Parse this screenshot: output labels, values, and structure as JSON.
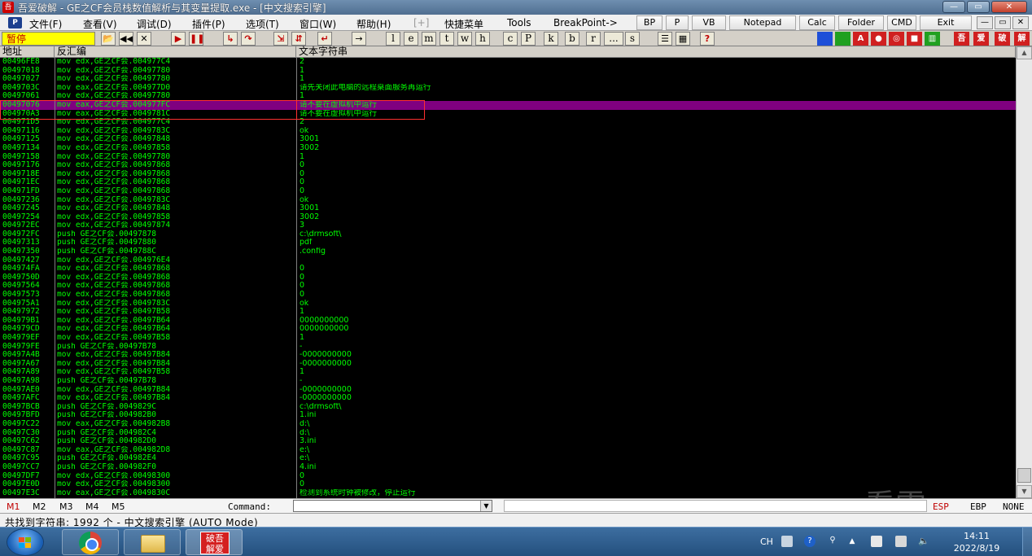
{
  "window": {
    "app_icon": "吾",
    "title": "吾爱破解 - GE之CF会员栈数值解析与其变量提取.exe - [中文搜索引擎]",
    "buttons": [
      "—",
      "▭",
      "✕"
    ]
  },
  "menubar": {
    "icon": "P",
    "items": [
      "文件(F)",
      "查看(V)",
      "调试(D)",
      "插件(P)",
      "选项(T)",
      "窗口(W)",
      "帮助(H)",
      "[+]",
      "快捷菜单",
      "Tools",
      "BreakPoint->"
    ],
    "quick_buttons": [
      "BP",
      "P",
      "VB",
      "Notepad",
      "Calc",
      "Folder",
      "CMD",
      "Exit"
    ],
    "mdi_buttons": [
      "—",
      "▭",
      "✕"
    ]
  },
  "toolbar": {
    "status": "暂停",
    "letters": [
      "l",
      "e",
      "m",
      "t",
      "w",
      "h",
      "c",
      "P",
      "k",
      "b",
      "r",
      "...",
      "s"
    ],
    "right_labels": [
      "吾",
      "爱",
      "破",
      "解"
    ],
    "right_colors": [
      "#1e4fd8",
      "#20a020",
      "#d02020",
      "#d02020",
      "#d02020",
      "#d02020",
      "#20a020",
      "#d02020",
      "#d02020",
      "#d02020",
      "#d02020"
    ]
  },
  "columns": {
    "address": "地址",
    "disasm": "反汇编",
    "text": "文本字符串"
  },
  "rows": [
    {
      "addr": "00496FE8",
      "asm": "mov edx,GE之CF会.004977C4",
      "text": "2"
    },
    {
      "addr": "00497018",
      "asm": "mov edx,GE之CF会.00497780",
      "text": "1"
    },
    {
      "addr": "00497027",
      "asm": "mov edx,GE之CF会.00497780",
      "text": "1"
    },
    {
      "addr": "0049703C",
      "asm": "mov eax,GE之CF会.004977D0",
      "text": "请先关闭此电脑的远程桌面服务再运行"
    },
    {
      "addr": "00497061",
      "asm": "mov edx,GE之CF会.00497780",
      "text": "1"
    },
    {
      "addr": "00497076",
      "asm": "mov eax,GE之CF会.004977FC",
      "text": "请不要在虚拟机中运行"
    },
    {
      "addr": "004970A3",
      "asm": "mov eax,GE之CF会.0049781C",
      "text": "请不要在虚拟机中运行"
    },
    {
      "addr": "004971D5",
      "asm": "mov edx,GE之CF会.004977C4",
      "text": "2"
    },
    {
      "addr": "00497116",
      "asm": "mov edx,GE之CF会.0049783C",
      "text": "ok"
    },
    {
      "addr": "00497125",
      "asm": "mov edx,GE之CF会.00497848",
      "text": "3001"
    },
    {
      "addr": "00497134",
      "asm": "mov edx,GE之CF会.00497858",
      "text": "3002"
    },
    {
      "addr": "00497158",
      "asm": "mov edx,GE之CF会.00497780",
      "text": "1"
    },
    {
      "addr": "00497176",
      "asm": "mov edx,GE之CF会.00497868",
      "text": "0"
    },
    {
      "addr": "0049718E",
      "asm": "mov edx,GE之CF会.00497868",
      "text": "0"
    },
    {
      "addr": "004971EC",
      "asm": "mov edx,GE之CF会.00497868",
      "text": "0"
    },
    {
      "addr": "004971FD",
      "asm": "mov edx,GE之CF会.00497868",
      "text": "0"
    },
    {
      "addr": "00497236",
      "asm": "mov edx,GE之CF会.0049783C",
      "text": "ok"
    },
    {
      "addr": "00497245",
      "asm": "mov edx,GE之CF会.00497848",
      "text": "3001"
    },
    {
      "addr": "00497254",
      "asm": "mov edx,GE之CF会.00497858",
      "text": "3002"
    },
    {
      "addr": "004972EC",
      "asm": "mov edx,GE之CF会.00497874",
      "text": "3"
    },
    {
      "addr": "004972FC",
      "asm": "push GE之CF会.00497878",
      "text": "c:\\drmsoft\\"
    },
    {
      "addr": "00497313",
      "asm": "push GE之CF会.00497880",
      "text": "pdf"
    },
    {
      "addr": "00497350",
      "asm": "push GE之CF会.0049788C",
      "text": ".config"
    },
    {
      "addr": "00497427",
      "asm": "mov edx,GE之CF会.004976E4",
      "text": ""
    },
    {
      "addr": "004974FA",
      "asm": "mov edx,GE之CF会.00497868",
      "text": "0"
    },
    {
      "addr": "0049750D",
      "asm": "mov edx,GE之CF会.00497868",
      "text": "0"
    },
    {
      "addr": "00497564",
      "asm": "mov edx,GE之CF会.00497868",
      "text": "0"
    },
    {
      "addr": "00497573",
      "asm": "mov edx,GE之CF会.00497868",
      "text": "0"
    },
    {
      "addr": "004975A1",
      "asm": "mov edx,GE之CF会.0049783C",
      "text": "ok"
    },
    {
      "addr": "00497972",
      "asm": "mov edx,GE之CF会.00497B58",
      "text": "1"
    },
    {
      "addr": "004979B1",
      "asm": "mov edx,GE之CF会.00497B64",
      "text": "0000000000"
    },
    {
      "addr": "004979CD",
      "asm": "mov edx,GE之CF会.00497B64",
      "text": "0000000000"
    },
    {
      "addr": "004979EF",
      "asm": "mov edx,GE之CF会.00497B58",
      "text": "1"
    },
    {
      "addr": "004979FE",
      "asm": "push GE之CF会.00497B78",
      "text": "-"
    },
    {
      "addr": "00497A4B",
      "asm": "mov edx,GE之CF会.00497B84",
      "text": "-0000000000"
    },
    {
      "addr": "00497A67",
      "asm": "mov edx,GE之CF会.00497B84",
      "text": "-0000000000"
    },
    {
      "addr": "00497A89",
      "asm": "mov edx,GE之CF会.00497B58",
      "text": "1"
    },
    {
      "addr": "00497A98",
      "asm": "push GE之CF会.00497B78",
      "text": "-"
    },
    {
      "addr": "00497AE0",
      "asm": "mov edx,GE之CF会.00497B84",
      "text": "-0000000000"
    },
    {
      "addr": "00497AFC",
      "asm": "mov edx,GE之CF会.00497B84",
      "text": "-0000000000"
    },
    {
      "addr": "00497BCB",
      "asm": "push GE之CF会.0049829C",
      "text": "c:\\drmsoft\\"
    },
    {
      "addr": "00497BFD",
      "asm": "push GE之CF会.004982B0",
      "text": "1.ini"
    },
    {
      "addr": "00497C22",
      "asm": "mov eax,GE之CF会.004982B8",
      "text": "d:\\"
    },
    {
      "addr": "00497C30",
      "asm": "push GE之CF会.004982C4",
      "text": "d:\\"
    },
    {
      "addr": "00497C62",
      "asm": "push GE之CF会.004982D0",
      "text": "3.ini"
    },
    {
      "addr": "00497C87",
      "asm": "mov eax,GE之CF会.004982D8",
      "text": "e:\\"
    },
    {
      "addr": "00497C95",
      "asm": "push GE之CF会.004982E4",
      "text": "e:\\"
    },
    {
      "addr": "00497CC7",
      "asm": "push GE之CF会.004982F0",
      "text": "4.ini"
    },
    {
      "addr": "00497DF7",
      "asm": "mov edx,GE之CF会.00498300",
      "text": "0"
    },
    {
      "addr": "00497E0D",
      "asm": "mov edx,GE之CF会.00498300",
      "text": "0"
    },
    {
      "addr": "00497E3C",
      "asm": "mov eax,GE之CF会.0049830C",
      "text": "检测到系统时钟被修改，停止运行"
    }
  ],
  "selected_row_index": 5,
  "command_bar": {
    "marks": [
      "M1",
      "M2",
      "M3",
      "M4",
      "M5"
    ],
    "label": "Command:",
    "input_value": "",
    "registers": [
      "ESP",
      "EBP",
      "NONE"
    ]
  },
  "status": {
    "text": "共找到字符串: 1992 个  -  中文搜索引擎 (AUTO Mode)"
  },
  "watermark": "看雪",
  "taskbar": {
    "app_icon_text": "破吾\n解爱",
    "lang": "CH",
    "time": "14:11",
    "date": "2022/8/19"
  }
}
